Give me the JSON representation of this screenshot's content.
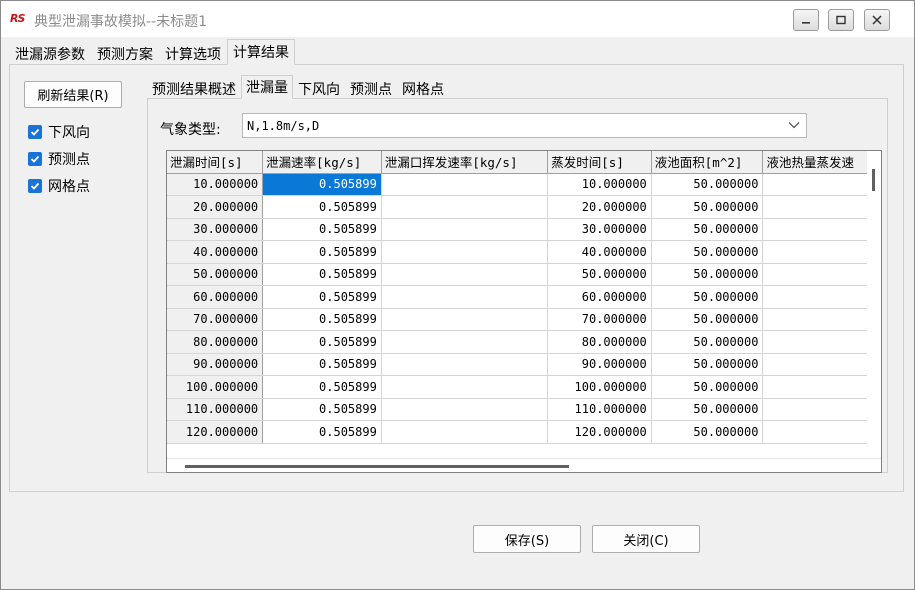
{
  "window": {
    "logo": "RS",
    "title": "典型泄漏事故模拟--未标题1"
  },
  "main_tabs": [
    {
      "label": "泄漏源参数"
    },
    {
      "label": "预测方案"
    },
    {
      "label": "计算选项"
    },
    {
      "label": "计算结果"
    }
  ],
  "sidebar": {
    "refresh_label": "刷新结果(R)",
    "checkboxes": [
      {
        "label": "下风向",
        "checked": true
      },
      {
        "label": "预测点",
        "checked": true
      },
      {
        "label": "网格点",
        "checked": true
      }
    ]
  },
  "sub_tabs": [
    {
      "label": "预测结果概述"
    },
    {
      "label": "泄漏量"
    },
    {
      "label": "下风向"
    },
    {
      "label": "预测点"
    },
    {
      "label": "网格点"
    }
  ],
  "weather": {
    "label": "气象类型:",
    "value": "N,1.8m/s,D"
  },
  "grid": {
    "columns": [
      "泄漏时间[s]",
      "泄漏速率[kg/s]",
      "泄漏口挥发速率[kg/s]",
      "蒸发时间[s]",
      "液池面积[m^2]",
      "液池热量蒸发速"
    ],
    "rows": [
      [
        "10.000000",
        "0.505899",
        "",
        "10.000000",
        "50.000000",
        ""
      ],
      [
        "20.000000",
        "0.505899",
        "",
        "20.000000",
        "50.000000",
        ""
      ],
      [
        "30.000000",
        "0.505899",
        "",
        "30.000000",
        "50.000000",
        ""
      ],
      [
        "40.000000",
        "0.505899",
        "",
        "40.000000",
        "50.000000",
        ""
      ],
      [
        "50.000000",
        "0.505899",
        "",
        "50.000000",
        "50.000000",
        ""
      ],
      [
        "60.000000",
        "0.505899",
        "",
        "60.000000",
        "50.000000",
        ""
      ],
      [
        "70.000000",
        "0.505899",
        "",
        "70.000000",
        "50.000000",
        ""
      ],
      [
        "80.000000",
        "0.505899",
        "",
        "80.000000",
        "50.000000",
        ""
      ],
      [
        "90.000000",
        "0.505899",
        "",
        "90.000000",
        "50.000000",
        ""
      ],
      [
        "100.000000",
        "0.505899",
        "",
        "100.000000",
        "50.000000",
        ""
      ],
      [
        "110.000000",
        "0.505899",
        "",
        "110.000000",
        "50.000000",
        ""
      ],
      [
        "120.000000",
        "0.505899",
        "",
        "120.000000",
        "50.000000",
        ""
      ]
    ]
  },
  "buttons": {
    "save": "保存(S)",
    "close": "关闭(C)"
  },
  "colors": {
    "selection": "#0a78d7",
    "checkbox": "#1a73d9",
    "logo": "#c01818"
  }
}
